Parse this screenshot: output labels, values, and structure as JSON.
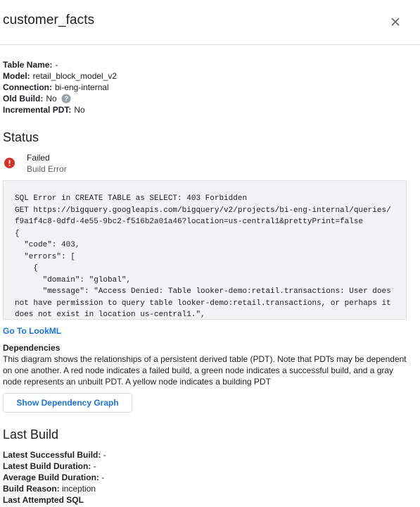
{
  "header": {
    "title": "customer_facts"
  },
  "info": {
    "table_name_label": "Table Name:",
    "table_name_value": "-",
    "model_label": "Model:",
    "model_value": "retail_block_model_v2",
    "connection_label": "Connection:",
    "connection_value": "bi-eng-internal",
    "old_build_label": "Old Build:",
    "old_build_value": "No",
    "incremental_label": "Incremental PDT:",
    "incremental_value": "No"
  },
  "status": {
    "heading": "Status",
    "state": "Failed",
    "detail": "Build Error",
    "error_icon_color": "#d93025",
    "error_text": "SQL Error in CREATE TABLE as SELECT: 403 Forbidden\nGET https://bigquery.googleapis.com/bigquery/v2/projects/bi-eng-internal/queries/f9a1f4c8-0dfd-4e55-9bc2-f516b2a01a46?location=us-central1&prettyPrint=false\n{\n  \"code\": 403,\n  \"errors\": [\n    {\n      \"domain\": \"global\",\n      \"message\": \"Access Denied: Table looker-demo:retail.transactions: User does not have permission to query table looker-demo:retail.transactions, or perhaps it does not exist in location us-central1.\","
  },
  "links": {
    "lookml": "Go To LookML",
    "link_color": "#1a73e8"
  },
  "dependencies": {
    "title": "Dependencies",
    "description": "This diagram shows the relationships of a persistent derived table (PDT). Note that PDTs may be dependent on one another. A red node indicates a failed build, a green node indicates a successful build, and a gray node represents an unbuilt PDT. A yellow node indicates a building PDT",
    "button": "Show Dependency Graph"
  },
  "last_build": {
    "heading": "Last Build",
    "latest_success_label": "Latest Successful Build:",
    "latest_success_value": "-",
    "latest_duration_label": "Latest Build Duration:",
    "latest_duration_value": "-",
    "average_duration_label": "Average Build Duration:",
    "average_duration_value": "-",
    "reason_label": "Build Reason:",
    "reason_value": "inception",
    "attempted_sql_label": "Last Attempted SQL"
  }
}
